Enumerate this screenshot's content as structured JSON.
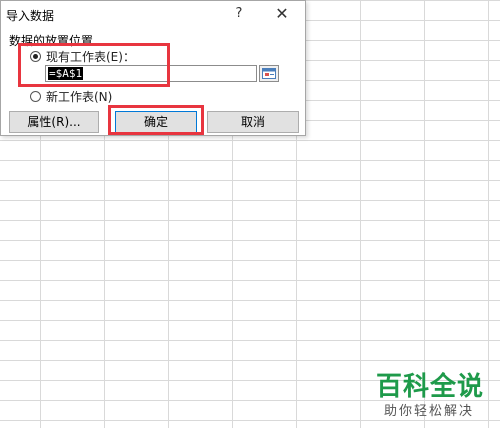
{
  "dialog": {
    "title": "导入数据",
    "help": "?",
    "close": "✕",
    "group_label": "数据的放置位置",
    "option_existing": "现有工作表(E)：",
    "option_new": "新工作表(N)",
    "range_value": "=$A$1",
    "properties_button": "属性(R)...",
    "ok_button": "确定",
    "cancel_button": "取消",
    "selected_option": "existing"
  },
  "colors": {
    "highlight": "#e8353f",
    "ok_border": "#0078d7",
    "watermark": "#1e9a4a"
  },
  "watermark": {
    "main": "百科全说",
    "sub": "助你轻松解决"
  }
}
